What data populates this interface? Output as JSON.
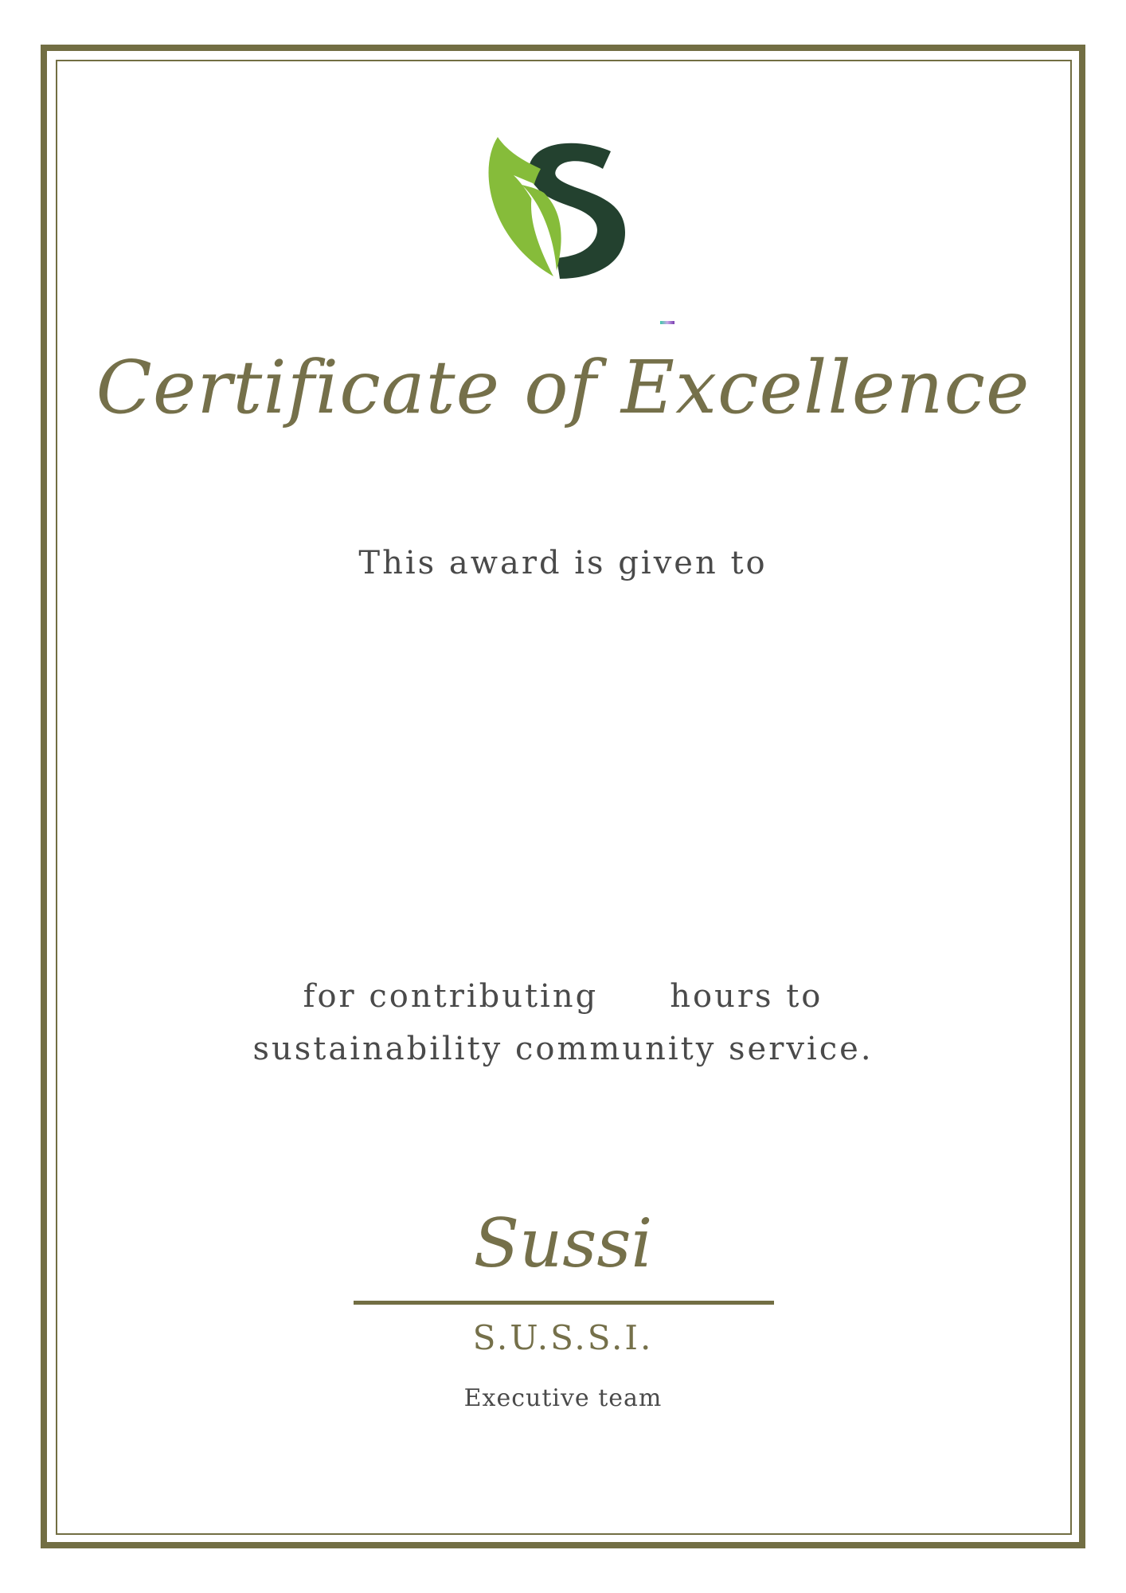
{
  "certificate": {
    "title": "Certificate of Excellence",
    "given_text": "This award is given to",
    "contrib_line1_a": "for contributing",
    "contrib_line1_b": "hours to",
    "contrib_line2": "sustainability community service.",
    "signature": "Sussi",
    "organization": "S.U.S.S.I.",
    "team": "Executive team"
  },
  "logo": {
    "icon": "leaf-s-logo-icon"
  },
  "colors": {
    "accent": "#726e43",
    "text": "#4a4a4a",
    "logo_green": "#86bc3a",
    "logo_dark": "#23412f"
  }
}
